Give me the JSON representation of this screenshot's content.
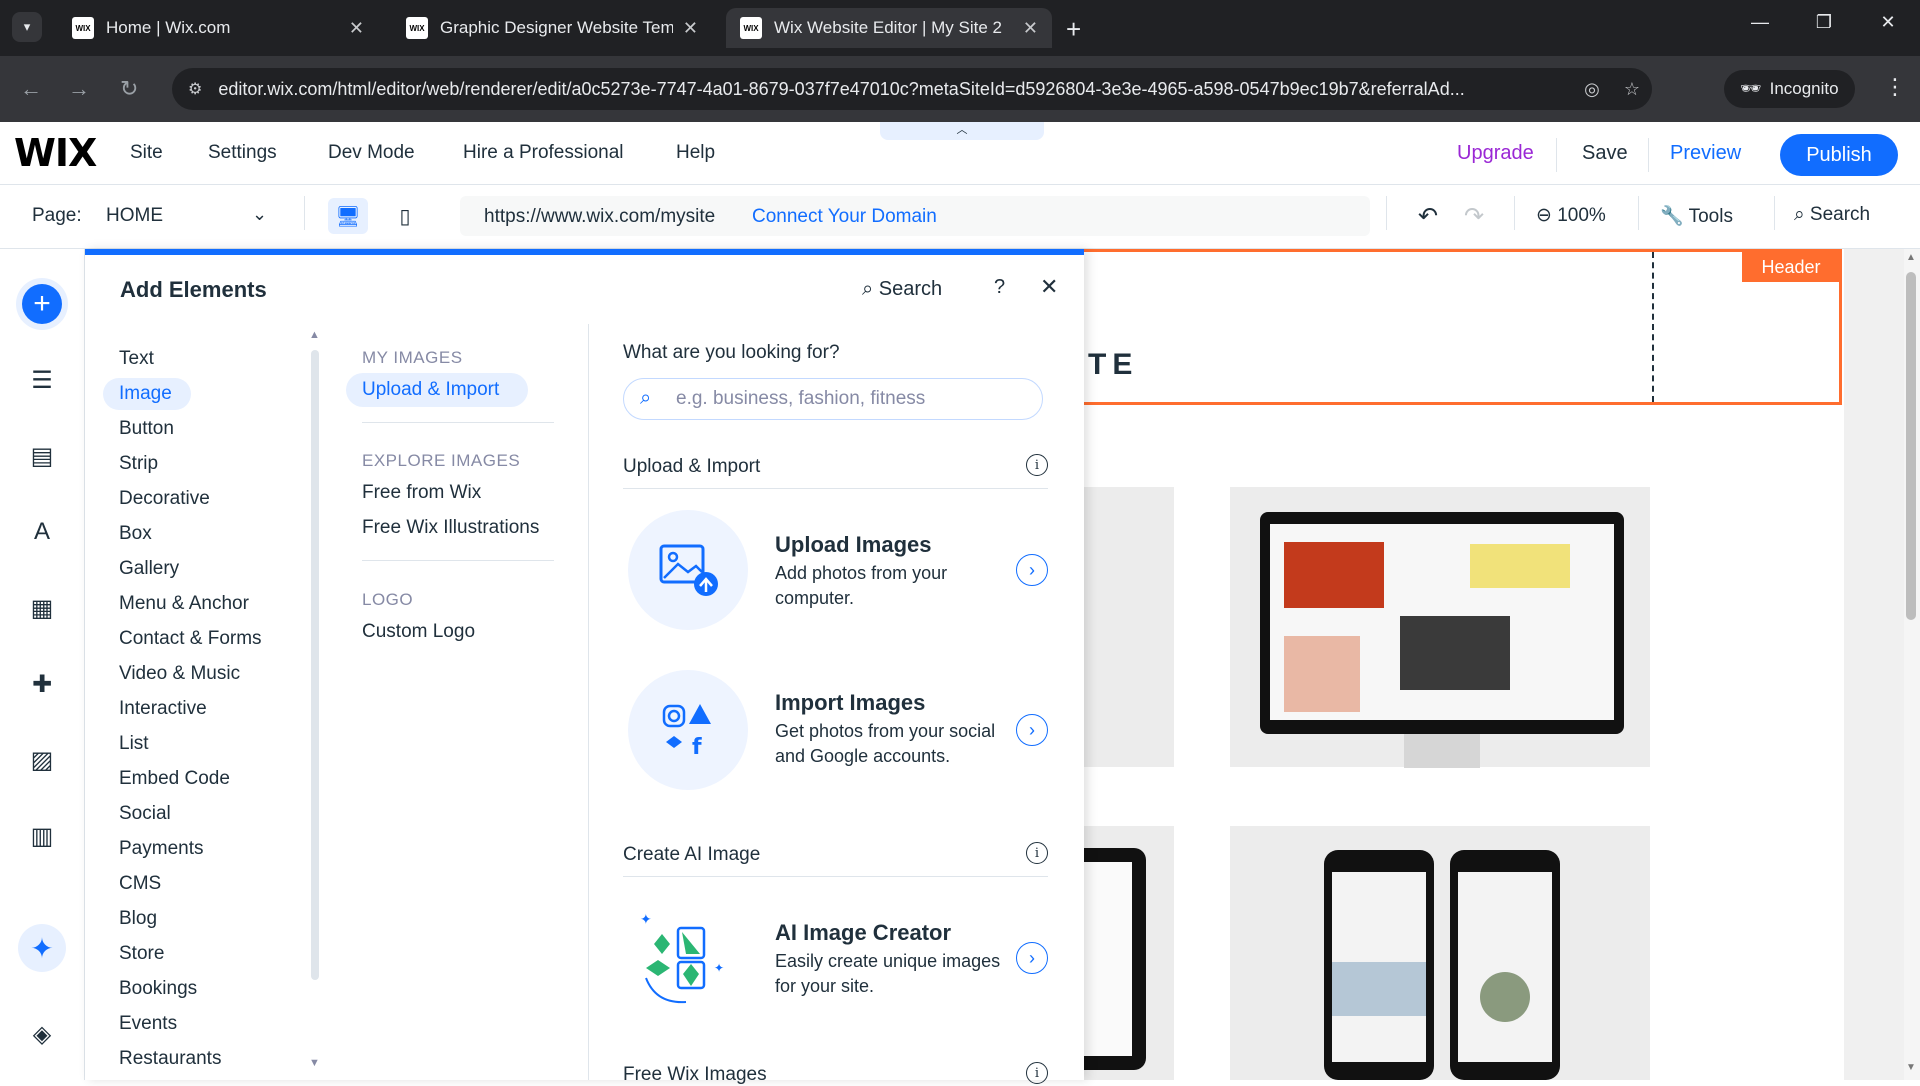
{
  "browser": {
    "tabs": [
      {
        "title": "Home | Wix.com",
        "favicon": "WIX"
      },
      {
        "title": "Graphic Designer Website Temp",
        "favicon": "WIX"
      },
      {
        "title": "Wix Website Editor | My Site 2",
        "favicon": "WIX"
      }
    ],
    "url": "editor.wix.com/html/editor/web/renderer/edit/a0c5273e-7747-4a01-8679-037f7e47010c?metaSiteId=d5926804-3e3e-4965-a598-0547b9ec19b7&referralAd...",
    "incognito_label": "Incognito"
  },
  "wix_bar": {
    "logo": "WIX",
    "menu": [
      "Site",
      "Settings",
      "Dev Mode",
      "Hire a Professional",
      "Help"
    ],
    "upgrade": "Upgrade",
    "save": "Save",
    "preview": "Preview",
    "publish": "Publish"
  },
  "page_bar": {
    "page_label": "Page:",
    "page_name": "HOME",
    "site_url": "https://www.wix.com/mysite",
    "connect_domain": "Connect Your Domain",
    "zoom": "100%",
    "tools": "Tools",
    "search": "Search"
  },
  "panel": {
    "title": "Add Elements",
    "search": "Search",
    "help": "?",
    "categories": [
      "Text",
      "Image",
      "Button",
      "Strip",
      "Decorative",
      "Box",
      "Gallery",
      "Menu & Anchor",
      "Contact & Forms",
      "Video & Music",
      "Interactive",
      "List",
      "Embed Code",
      "Social",
      "Payments",
      "CMS",
      "Blog",
      "Store",
      "Bookings",
      "Events",
      "Restaurants"
    ],
    "active_category": "Image",
    "sections": {
      "my_images": "MY IMAGES",
      "upload_import": "Upload & Import",
      "explore_images": "EXPLORE IMAGES",
      "free_from_wix": "Free from Wix",
      "free_wix_illustrations": "Free Wix Illustrations",
      "logo": "LOGO",
      "custom_logo": "Custom Logo"
    },
    "content": {
      "question": "What are you looking for?",
      "search_placeholder": "e.g. business, fashion, fitness",
      "upload_heading": "Upload & Import",
      "upload_title": "Upload Images",
      "upload_desc": "Add photos from your computer.",
      "import_title": "Import Images",
      "import_desc": "Get photos from your social and Google accounts.",
      "ai_heading": "Create AI Image",
      "ai_title": "AI Image Creator",
      "ai_desc": "Easily create unique images for your site.",
      "free_heading": "Free Wix Images"
    }
  },
  "canvas": {
    "header_tag": "Header",
    "site_title_fragment": "TE"
  },
  "colors": {
    "accent": "#116dff",
    "header_orange": "#ff6d2e",
    "upgrade_purple": "#9a27d5"
  }
}
